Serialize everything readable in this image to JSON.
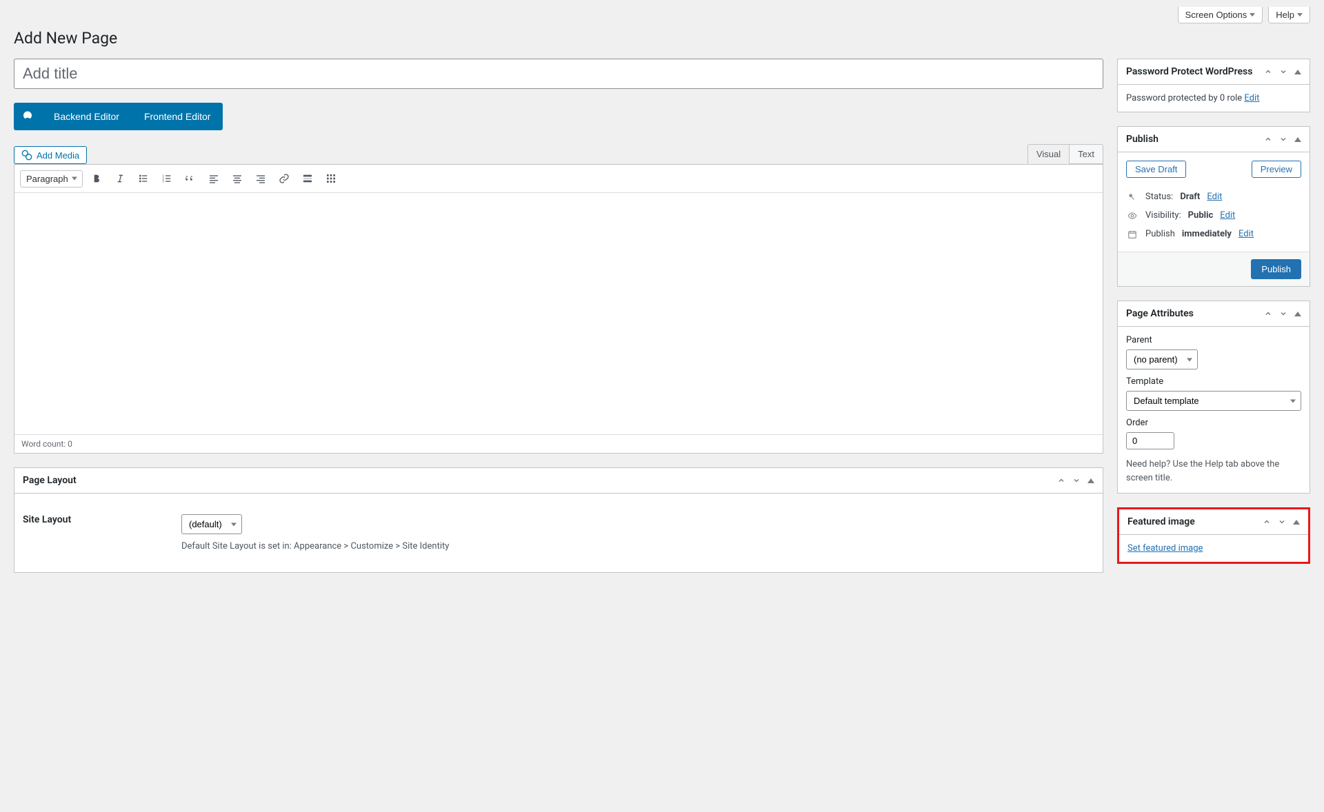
{
  "topbar": {
    "screen_options": "Screen Options",
    "help": "Help"
  },
  "heading": "Add New Page",
  "title_placeholder": "Add title",
  "editor_switch": {
    "backend": "Backend Editor",
    "frontend": "Frontend Editor"
  },
  "add_media": "Add Media",
  "mode_tabs": {
    "visual": "Visual",
    "text": "Text"
  },
  "format_select": "Paragraph",
  "word_count_label": "Word count: 0",
  "page_layout_box": {
    "title": "Page Layout",
    "site_layout_label": "Site Layout",
    "site_layout_value": "(default)",
    "note": "Default Site Layout is set in: Appearance > Customize > Site Identity"
  },
  "password_protect_box": {
    "title": "Password Protect WordPress",
    "text": "Password protected by 0 role ",
    "edit": "Edit"
  },
  "publish_box": {
    "title": "Publish",
    "save_draft": "Save Draft",
    "preview": "Preview",
    "status_label": "Status:",
    "status_value": "Draft",
    "visibility_label": "Visibility:",
    "visibility_value": "Public",
    "publish_label": "Publish ",
    "publish_value": "immediately",
    "edit": "Edit",
    "publish_btn": "Publish"
  },
  "page_attributes_box": {
    "title": "Page Attributes",
    "parent_label": "Parent",
    "parent_value": "(no parent)",
    "template_label": "Template",
    "template_value": "Default template",
    "order_label": "Order",
    "order_value": "0",
    "help": "Need help? Use the Help tab above the screen title."
  },
  "featured_image_box": {
    "title": "Featured image",
    "set_link": "Set featured image"
  }
}
